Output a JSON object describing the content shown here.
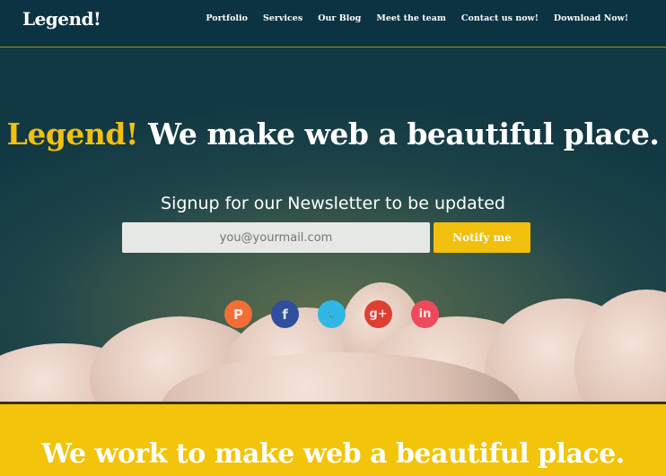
{
  "header": {
    "logo": "Legend!",
    "nav": [
      "Portfolio",
      "Services",
      "Our Blog",
      "Meet the team",
      "Contact us now!",
      "Download Now!"
    ]
  },
  "hero": {
    "headline_brand": "Legend!",
    "headline_rest": "We make web a beautiful place.",
    "signup_text": "Signup for our Newsletter to be updated",
    "email_placeholder": "you@yourmail.com",
    "notify_label": "Notify me",
    "social": [
      {
        "name": "pinterest",
        "glyph": "P",
        "color": "#f36e36"
      },
      {
        "name": "facebook",
        "glyph": "f",
        "color": "#2f4f9e"
      },
      {
        "name": "twitter",
        "glyph": "🐦",
        "color": "#2fb8e6"
      },
      {
        "name": "google-plus",
        "glyph": "g+",
        "color": "#de3f32"
      },
      {
        "name": "linkedin",
        "glyph": "in",
        "color": "#ee4a5c"
      }
    ]
  },
  "band": {
    "title": "We work to make web a beautiful place."
  },
  "colors": {
    "accent": "#f2c010",
    "header_bg": "#0c3342"
  }
}
